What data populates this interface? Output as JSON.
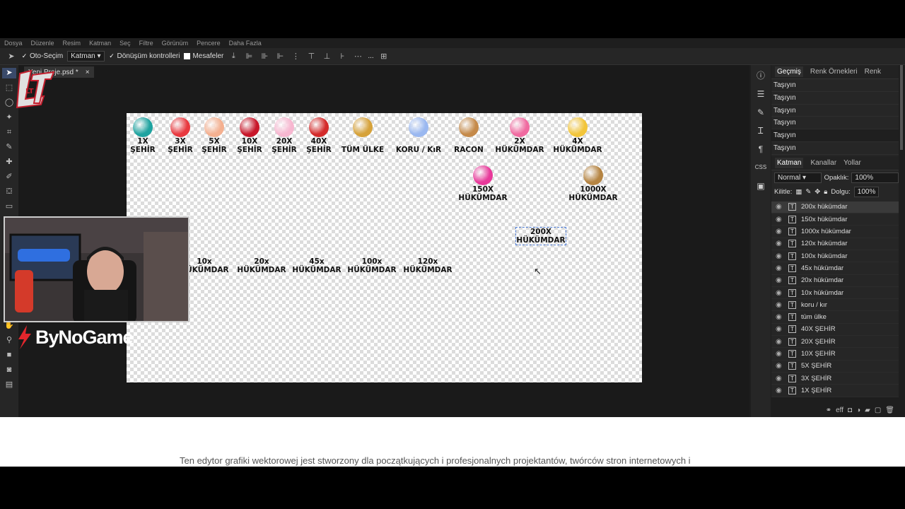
{
  "menubar": [
    "Dosya",
    "Düzenle",
    "Resim",
    "Katman",
    "Seç",
    "Filtre",
    "Görünüm",
    "Pencere",
    "Daha Fazla"
  ],
  "options": {
    "auto_select": "Oto-Seçim",
    "target_select": "Katman",
    "transform_controls": "Dönüşüm kontrolleri",
    "distances": "Mesafeler",
    "more": "..."
  },
  "document": {
    "tab_title": "Yeni Proje.psd *",
    "close": "×"
  },
  "gifts": [
    {
      "label": "1X\nŞEHİR",
      "color": "#1fa3a0"
    },
    {
      "label": "3X\nŞEHİR",
      "color": "#e8393f"
    },
    {
      "label": "5X\nŞEHİR",
      "color": "#f4b090"
    },
    {
      "label": "10X\nŞEHİR",
      "color": "#c8172a"
    },
    {
      "label": "20X\nŞEHİR",
      "color": "#f7b7d0"
    },
    {
      "label": "40X\nŞEHİR",
      "color": "#d42b2b"
    },
    {
      "label": "TÜM ÜLKE",
      "color": "#d6a23a"
    },
    {
      "label": "KORU / KıR",
      "color": "#9ab8f0"
    },
    {
      "label": "RACON",
      "color": "#c58a4a"
    },
    {
      "label": "2X\nHÜKÜMDAR",
      "color": "#f06aa0"
    },
    {
      "label": "4X\nHÜKÜMDAR",
      "color": "#f2c53a"
    },
    {
      "label": "150X\nHÜKÜMDAR",
      "color": "#e8399a"
    },
    {
      "label": "1000X\nHÜKÜMDAR",
      "color": "#b58442"
    },
    {
      "label": "200X\nHÜKÜMDAR",
      "color": ""
    },
    {
      "label": "10x\nHÜKÜMDAR",
      "color": ""
    },
    {
      "label": "20x\nHÜKÜMDAR",
      "color": ""
    },
    {
      "label": "45x\nHÜKÜMDAR",
      "color": ""
    },
    {
      "label": "100x\nHÜKÜMDAR",
      "color": ""
    },
    {
      "label": "120x\nHÜKÜMDAR",
      "color": ""
    }
  ],
  "history_panel": {
    "tabs": [
      "Geçmiş",
      "Renk Örnekleri",
      "Renk"
    ],
    "rows": [
      "Taşıyın",
      "Taşıyın",
      "Taşıyın",
      "Taşıyın",
      "Taşıyın",
      "Taşıyın"
    ]
  },
  "layers_panel": {
    "tabs": [
      "Katman",
      "Kanallar",
      "Yollar"
    ],
    "blend_mode": "Normal",
    "opacity_label": "Opaklık:",
    "opacity_value": "100%",
    "lock_label": "Kilitle:",
    "fill_label": "Dolgu:",
    "fill_value": "100%",
    "layers": [
      "200x hükümdar",
      "150x hükümdar",
      "1000x hükümdar",
      "120x hükümdar",
      "100x hükümdar",
      "45x hükümdar",
      "20x hükümdar",
      "10x hükümdar",
      "koru / kır",
      "tüm ülke",
      "40X ŞEHİR",
      "20X ŞEHİR",
      "10X ŞEHİR",
      "5X ŞEHİR",
      "3X ŞEHİR",
      "1X ŞEHİR"
    ]
  },
  "overlay": {
    "sponsor": "ByNoGame",
    "logo_text": "LT"
  },
  "web": {
    "footer_text": "Ten edytor grafiki wektorowej jest stworzony dla początkujących i profesjonalnych projektantów, twórców stron internetowych i"
  }
}
